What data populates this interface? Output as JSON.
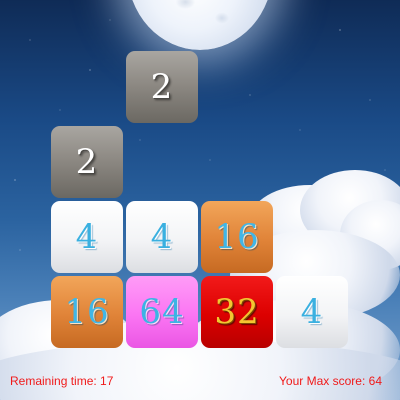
{
  "board": {
    "tiles": [
      {
        "value": "2",
        "style": "grey"
      },
      {
        "value": "2",
        "style": "grey"
      },
      {
        "value": "4",
        "style": "white"
      },
      {
        "value": "4",
        "style": "white"
      },
      {
        "value": "16",
        "style": "orange"
      },
      {
        "value": "16",
        "style": "orange"
      },
      {
        "value": "64",
        "style": "pink"
      },
      {
        "value": "32",
        "style": "red"
      },
      {
        "value": "4",
        "style": "white"
      }
    ]
  },
  "hud": {
    "remaining_time_label": "Remaining time:",
    "remaining_time_value": "17",
    "max_score_label": "Your Max score:",
    "max_score_value": "64"
  },
  "colors": {
    "hud_text": "#f01a1a",
    "tile_grey": "#8e8a84",
    "tile_white": "#f3f4f6",
    "tile_orange": "#e08338",
    "tile_pink": "#fb75f3",
    "tile_red": "#dc0000",
    "number_blue": "#3ab0e0",
    "number_gold": "#f4c531"
  }
}
